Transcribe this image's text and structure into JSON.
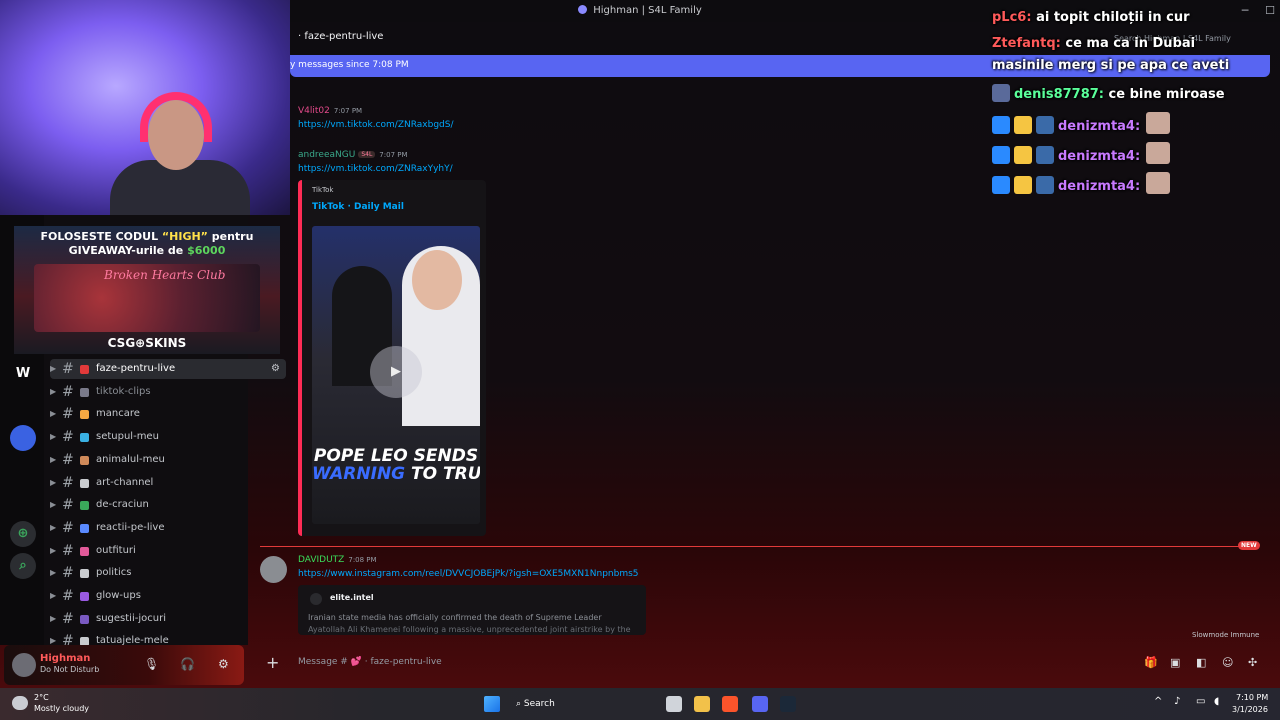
{
  "window": {
    "title": "Highman | S4L Family",
    "min": "─",
    "max": "☐",
    "close": "✕"
  },
  "server_rail": {
    "items": [
      "W",
      "⊕",
      "⌕"
    ]
  },
  "channels": [
    {
      "name": "faze-pentru-live",
      "color": "#e23a3a",
      "active": true
    },
    {
      "name": "tiktok-clips",
      "color": "#7a7a8a",
      "muted": true
    },
    {
      "name": "mancare",
      "color": "#f5a742"
    },
    {
      "name": "setupul-meu",
      "color": "#3ab0e2"
    },
    {
      "name": "animalul-meu",
      "color": "#d08a5a"
    },
    {
      "name": "art-channel",
      "color": "#c9cbcf"
    },
    {
      "name": "de-craciun",
      "color": "#3aa85a"
    },
    {
      "name": "reactii-pe-live",
      "color": "#5a8aff"
    },
    {
      "name": "outfituri",
      "color": "#e25a9a"
    },
    {
      "name": "politics",
      "color": "#c9cbcf"
    },
    {
      "name": "glow-ups",
      "color": "#9a5ae2"
    },
    {
      "name": "sugestii-jocuri",
      "color": "#7a5ac2"
    },
    {
      "name": "tatuajele-mele",
      "color": "#c9cbcf"
    }
  ],
  "user_panel": {
    "name": "Highman",
    "status": "Do Not Disturb",
    "mic": "🎙",
    "headset": "🎧",
    "settings": "⚙"
  },
  "promo": {
    "line1_pre": "FOLOSESTE CODUL ",
    "code": "“HIGH”",
    "line1_post": " pentru",
    "line2_pre": "GIVEAWAY-urile de ",
    "amount": "$6000",
    "scene_text": "Broken Hearts Club",
    "brand": "CSG⊕SKINS"
  },
  "chat": {
    "channel_name": "faze-pentru-live",
    "new_messages_bar": "y messages since 7:08 PM",
    "search_placeholder": "Search Highman | S4L Family",
    "messages": [
      {
        "author": "V4lit02",
        "author_color": "#e24a8a",
        "time": "7:07 PM",
        "link": "https://vm.tiktok.com/ZNRaxbgdS/"
      },
      {
        "author": "andreeaNGU",
        "author_color": "#3aa88a",
        "badge": "S4L",
        "time": "7:07 PM",
        "link": "https://vm.tiktok.com/ZNRaxYyhY/"
      },
      {
        "author": "DAVIDUTZ",
        "author_color": "#3adc5a",
        "time": "7:08 PM",
        "link": "https://www.instagram.com/reel/DVVCJOBEjPk/?igsh=OXE5MXN1Nnpnbms5"
      }
    ],
    "embed": {
      "provider": "TikTok",
      "title": "TikTok · Daily Mail",
      "headline1": "POPE LEO SENDS",
      "headline2_blue": "WARNING",
      "headline2_rest": " TO TRUMP"
    },
    "embed2": {
      "author": "elite.intel",
      "desc1": "Iranian state media has officially confirmed the death of Supreme Leader",
      "desc2": "Ayatollah Ali Khamenei following a massive, unprecedented joint airstrike by the"
    },
    "new_tag": "NEW",
    "slowmode": "Slowmode Immune",
    "composer_placeholder": "Message # 💕 · faze-pentru-live"
  },
  "overlay_chat": [
    {
      "user": "pLc6:",
      "user_color": "#ff5a5a",
      "text": " ai topit chiloții in cur"
    },
    {
      "user": "Ztefantq:",
      "user_color": "#ff5a5a",
      "text": " ce ma ca in Dubai"
    },
    {
      "user": "",
      "user_color": "#ffffff",
      "text": "masinile merg si pe apa ce aveti"
    },
    {
      "user": "denis87787:",
      "user_color": "#5aff9a",
      "text": " ce bine miroase"
    },
    {
      "user": "denizmta4:",
      "user_color": "#c87aff",
      "text": ""
    },
    {
      "user": "denizmta4:",
      "user_color": "#c87aff",
      "text": ""
    },
    {
      "user": "denizmta4:",
      "user_color": "#c87aff",
      "text": ""
    }
  ],
  "taskbar": {
    "temp": "2°C",
    "weather": "Mostly cloudy",
    "search": "Search",
    "time": "7:10 PM",
    "date": "3/1/2026"
  }
}
